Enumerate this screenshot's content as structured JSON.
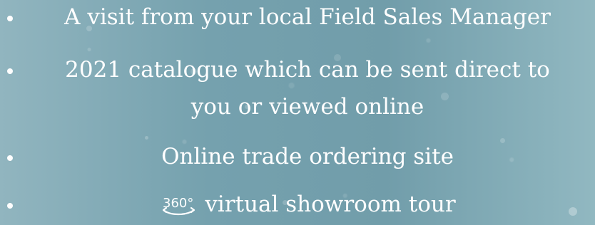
{
  "bullets": [
    {
      "text": "A visit from your local Field Sales Manager"
    },
    {
      "text": "2021 catalogue which can be sent direct to"
    },
    {
      "continuation": "you or viewed online"
    },
    {
      "text": "Online trade ordering site"
    },
    {
      "icon": "360-icon",
      "text": "virtual showroom tour"
    }
  ],
  "colors": {
    "text": "#ffffff",
    "background": "#7ea7b4"
  }
}
